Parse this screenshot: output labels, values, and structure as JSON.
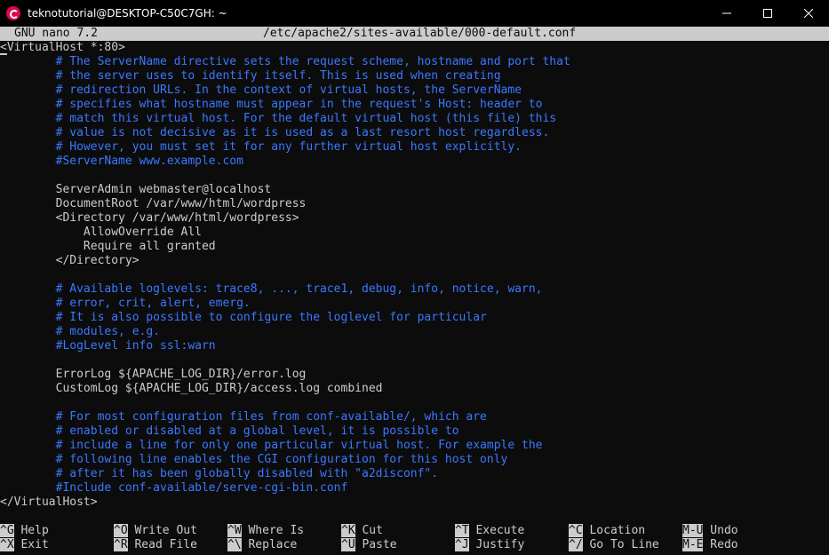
{
  "window": {
    "title": "teknotutorial@DESKTOP-C50C7GH: ~",
    "minimize_glyph": "─",
    "maximize_glyph": "☐",
    "close_glyph": "✕"
  },
  "nano": {
    "version": "GNU nano 7.2",
    "filename": "/etc/apache2/sites-available/000-default.conf"
  },
  "file_lines": [
    {
      "text": "<VirtualHost *:80>",
      "type": "plain",
      "cursor": true
    },
    {
      "text": "        # The ServerName directive sets the request scheme, hostname and port that",
      "type": "comment"
    },
    {
      "text": "        # the server uses to identify itself. This is used when creating",
      "type": "comment"
    },
    {
      "text": "        # redirection URLs. In the context of virtual hosts, the ServerName",
      "type": "comment"
    },
    {
      "text": "        # specifies what hostname must appear in the request's Host: header to",
      "type": "comment"
    },
    {
      "text": "        # match this virtual host. For the default virtual host (this file) this",
      "type": "comment"
    },
    {
      "text": "        # value is not decisive as it is used as a last resort host regardless.",
      "type": "comment"
    },
    {
      "text": "        # However, you must set it for any further virtual host explicitly.",
      "type": "comment"
    },
    {
      "text": "        #ServerName www.example.com",
      "type": "comment"
    },
    {
      "text": "",
      "type": "plain"
    },
    {
      "text": "        ServerAdmin webmaster@localhost",
      "type": "plain"
    },
    {
      "text": "        DocumentRoot /var/www/html/wordpress",
      "type": "plain"
    },
    {
      "text": "        <Directory /var/www/html/wordpress>",
      "type": "plain"
    },
    {
      "text": "            AllowOverride All",
      "type": "plain"
    },
    {
      "text": "            Require all granted",
      "type": "plain"
    },
    {
      "text": "        </Directory>",
      "type": "plain"
    },
    {
      "text": "",
      "type": "plain"
    },
    {
      "text": "        # Available loglevels: trace8, ..., trace1, debug, info, notice, warn,",
      "type": "comment"
    },
    {
      "text": "        # error, crit, alert, emerg.",
      "type": "comment"
    },
    {
      "text": "        # It is also possible to configure the loglevel for particular",
      "type": "comment"
    },
    {
      "text": "        # modules, e.g.",
      "type": "comment"
    },
    {
      "text": "        #LogLevel info ssl:warn",
      "type": "comment"
    },
    {
      "text": "",
      "type": "plain"
    },
    {
      "text": "        ErrorLog ${APACHE_LOG_DIR}/error.log",
      "type": "plain"
    },
    {
      "text": "        CustomLog ${APACHE_LOG_DIR}/access.log combined",
      "type": "plain"
    },
    {
      "text": "",
      "type": "plain"
    },
    {
      "text": "        # For most configuration files from conf-available/, which are",
      "type": "comment"
    },
    {
      "text": "        # enabled or disabled at a global level, it is possible to",
      "type": "comment"
    },
    {
      "text": "        # include a line for only one particular virtual host. For example the",
      "type": "comment"
    },
    {
      "text": "        # following line enables the CGI configuration for this host only",
      "type": "comment"
    },
    {
      "text": "        # after it has been globally disabled with \"a2disconf\".",
      "type": "comment"
    },
    {
      "text": "        #Include conf-available/serve-cgi-bin.conf",
      "type": "comment"
    },
    {
      "text": "</VirtualHost>",
      "type": "plain"
    }
  ],
  "shortcuts": {
    "row1": [
      {
        "key": "^G",
        "label": " Help"
      },
      {
        "key": "^O",
        "label": " Write Out"
      },
      {
        "key": "^W",
        "label": " Where Is"
      },
      {
        "key": "^K",
        "label": " Cut"
      },
      {
        "key": "^T",
        "label": " Execute"
      },
      {
        "key": "^C",
        "label": " Location"
      },
      {
        "key": "M-U",
        "label": " Undo"
      }
    ],
    "row2": [
      {
        "key": "^X",
        "label": " Exit"
      },
      {
        "key": "^R",
        "label": " Read File"
      },
      {
        "key": "^\\",
        "label": " Replace"
      },
      {
        "key": "^U",
        "label": " Paste"
      },
      {
        "key": "^J",
        "label": " Justify"
      },
      {
        "key": "^/",
        "label": " Go To Line"
      },
      {
        "key": "M-E",
        "label": " Redo"
      }
    ]
  },
  "colors": {
    "background": "#0c0c0c",
    "foreground": "#cccccc",
    "comment": "#3b78ff",
    "app_icon": "#d70a53"
  }
}
